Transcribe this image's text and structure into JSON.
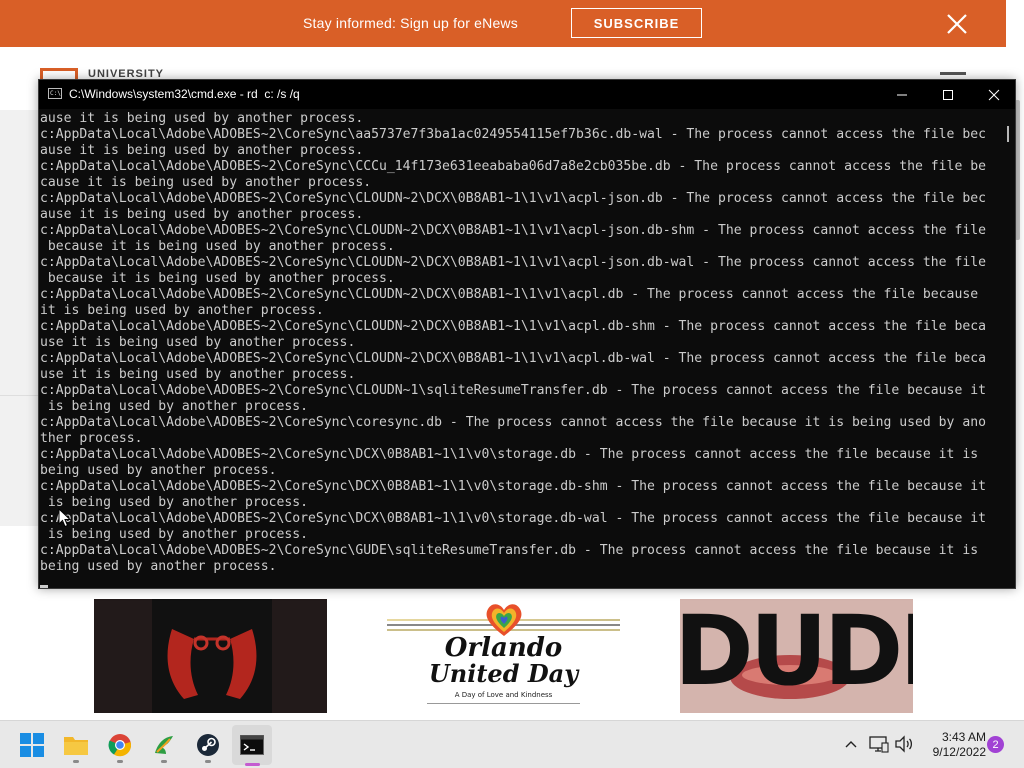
{
  "banner": {
    "text": "Stay informed: Sign up for eNews",
    "subscribe_label": "SUBSCRIBE",
    "bg_color": "#d95f27"
  },
  "site": {
    "logo_text": "UNIVERSITY"
  },
  "cmd": {
    "title": "C:\\Windows\\system32\\cmd.exe - rd  c: /s /q",
    "lines": [
      "ause it is being used by another process.",
      "c:AppData\\Local\\Adobe\\ADOBES~2\\CoreSync\\aa5737e7f3ba1ac0249554115ef7b36c.db-wal - The process cannot access the file bec",
      "ause it is being used by another process.",
      "c:AppData\\Local\\Adobe\\ADOBES~2\\CoreSync\\CCCu_14f173e631eeababa06d7a8e2cb035be.db - The process cannot access the file be",
      "cause it is being used by another process.",
      "c:AppData\\Local\\Adobe\\ADOBES~2\\CoreSync\\CLOUDN~2\\DCX\\0B8AB1~1\\1\\v1\\acpl-json.db - The process cannot access the file bec",
      "ause it is being used by another process.",
      "c:AppData\\Local\\Adobe\\ADOBES~2\\CoreSync\\CLOUDN~2\\DCX\\0B8AB1~1\\1\\v1\\acpl-json.db-shm - The process cannot access the file",
      " because it is being used by another process.",
      "c:AppData\\Local\\Adobe\\ADOBES~2\\CoreSync\\CLOUDN~2\\DCX\\0B8AB1~1\\1\\v1\\acpl-json.db-wal - The process cannot access the file",
      " because it is being used by another process.",
      "c:AppData\\Local\\Adobe\\ADOBES~2\\CoreSync\\CLOUDN~2\\DCX\\0B8AB1~1\\1\\v1\\acpl.db - The process cannot access the file because",
      "it is being used by another process.",
      "c:AppData\\Local\\Adobe\\ADOBES~2\\CoreSync\\CLOUDN~2\\DCX\\0B8AB1~1\\1\\v1\\acpl.db-shm - The process cannot access the file beca",
      "use it is being used by another process.",
      "c:AppData\\Local\\Adobe\\ADOBES~2\\CoreSync\\CLOUDN~2\\DCX\\0B8AB1~1\\1\\v1\\acpl.db-wal - The process cannot access the file beca",
      "use it is being used by another process.",
      "c:AppData\\Local\\Adobe\\ADOBES~2\\CoreSync\\CLOUDN~1\\sqliteResumeTransfer.db - The process cannot access the file because it",
      " is being used by another process.",
      "c:AppData\\Local\\Adobe\\ADOBES~2\\CoreSync\\coresync.db - The process cannot access the file because it is being used by ano",
      "ther process.",
      "c:AppData\\Local\\Adobe\\ADOBES~2\\CoreSync\\DCX\\0B8AB1~1\\1\\v0\\storage.db - The process cannot access the file because it is",
      "being used by another process.",
      "c:AppData\\Local\\Adobe\\ADOBES~2\\CoreSync\\DCX\\0B8AB1~1\\1\\v0\\storage.db-shm - The process cannot access the file because it",
      " is being used by another process.",
      "c:AppData\\Local\\Adobe\\ADOBES~2\\CoreSync\\DCX\\0B8AB1~1\\1\\v0\\storage.db-wal - The process cannot access the file because it",
      " is being used by another process.",
      "c:AppData\\Local\\Adobe\\ADOBES~2\\CoreSync\\GUDE\\sqliteResumeTransfer.db - The process cannot access the file because it is",
      "being used by another process."
    ]
  },
  "thumbnails": {
    "orlando_line1": "Orlando",
    "orlando_line2": "United Day",
    "orlando_sub": "A Day of Love and Kindness",
    "dude_text": "DUDE"
  },
  "taskbar": {
    "apps": [
      {
        "name": "windows-start-icon"
      },
      {
        "name": "file-explorer-icon"
      },
      {
        "name": "chrome-icon"
      },
      {
        "name": "app-bird-icon"
      },
      {
        "name": "steam-icon"
      },
      {
        "name": "terminal-icon"
      }
    ],
    "time": "3:43 AM",
    "date": "9/12/2022",
    "notification_count": "2"
  }
}
